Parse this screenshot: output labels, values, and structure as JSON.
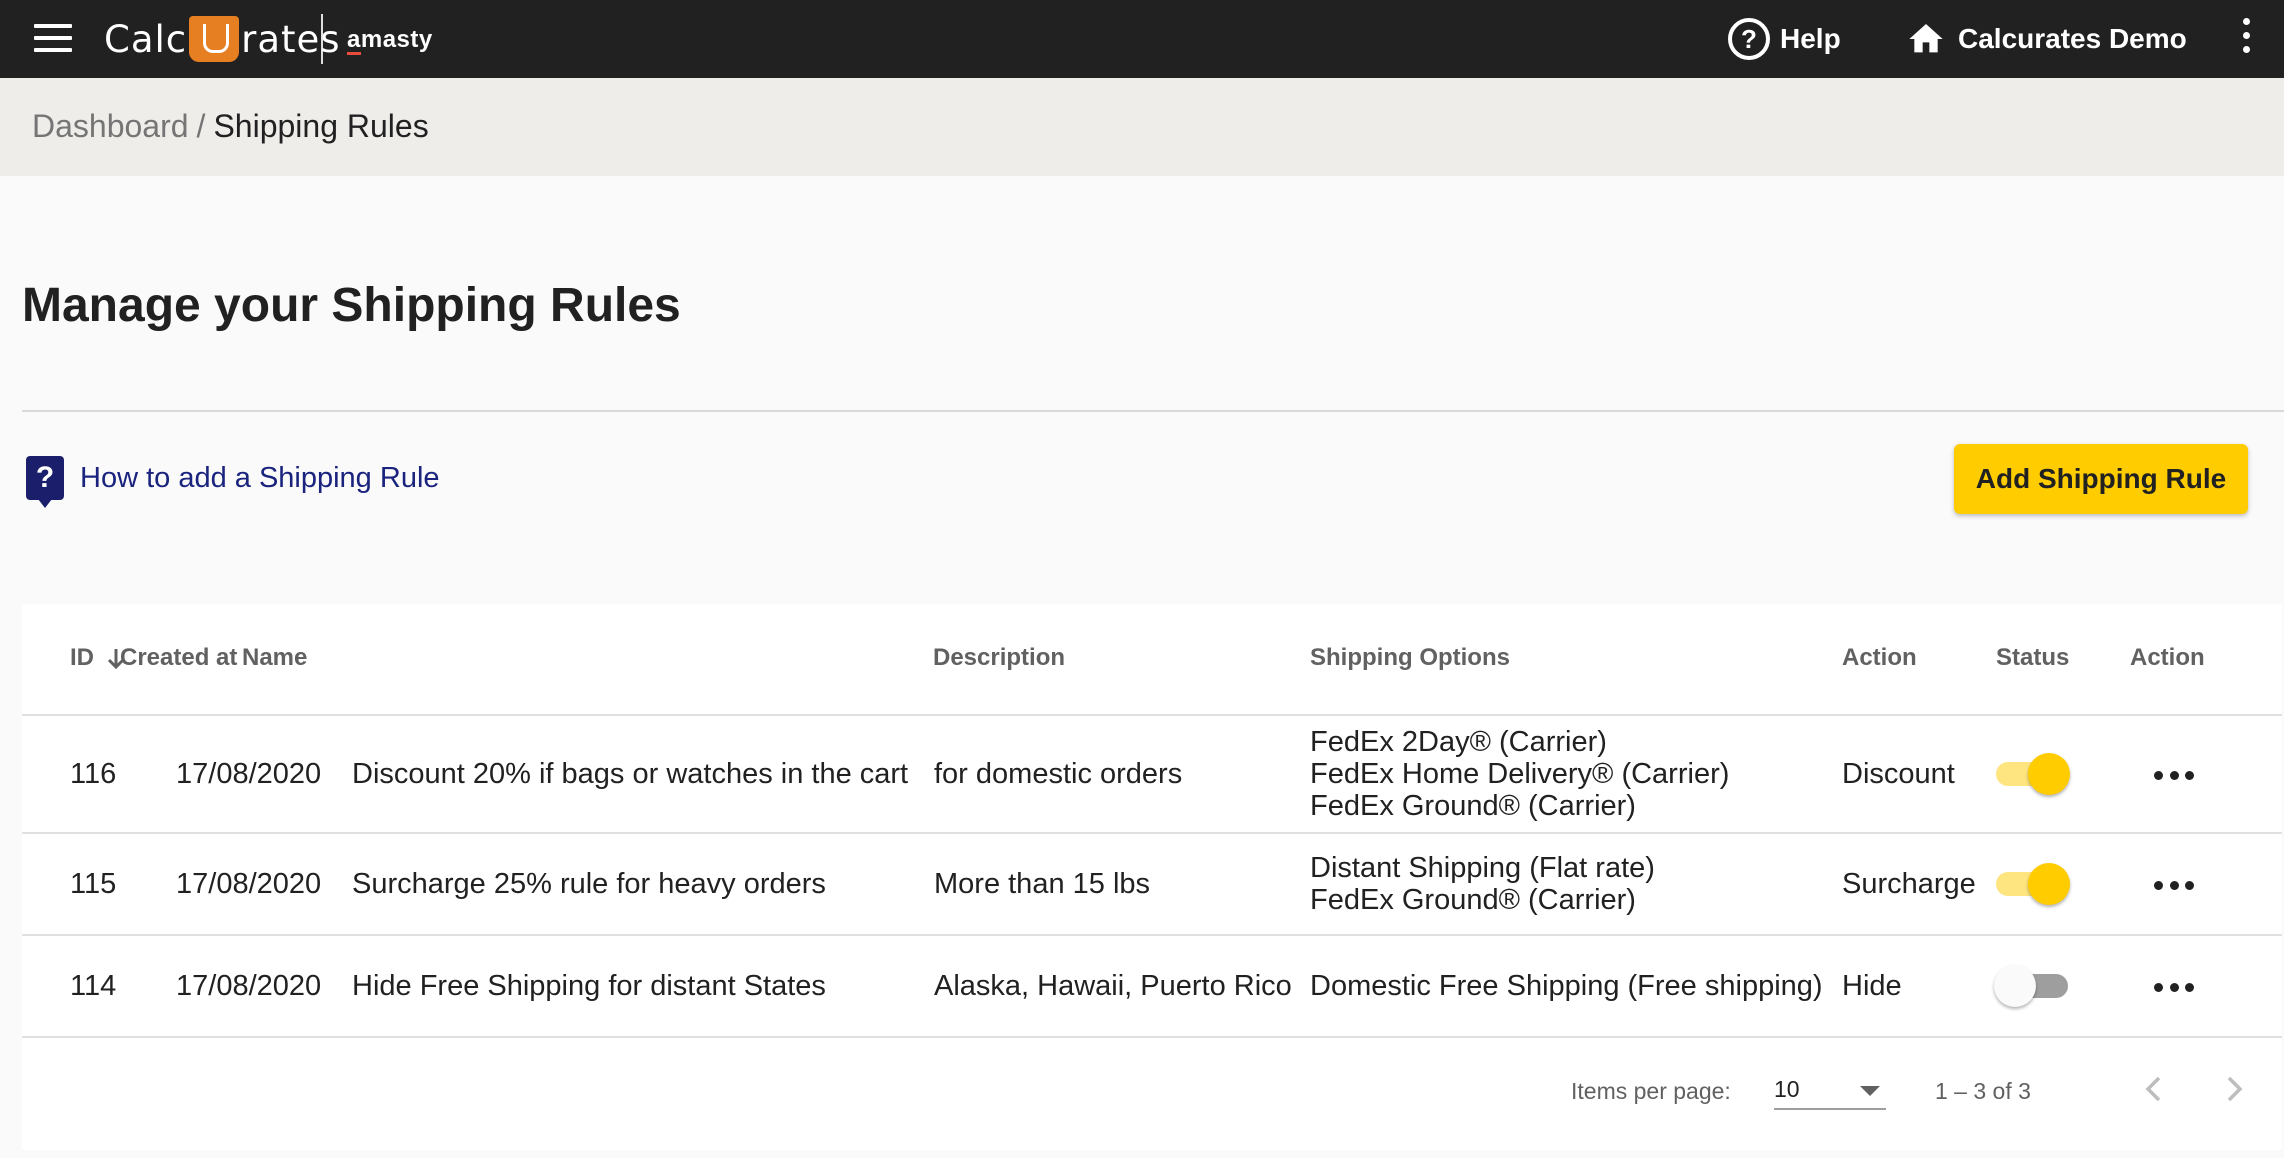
{
  "header": {
    "logo_left": "Calc",
    "logo_right": "rates",
    "brand2": "amasty",
    "help_label": "Help",
    "store_label": "Calcurates Demo"
  },
  "breadcrumb": {
    "parent": "Dashboard",
    "separator": "/",
    "current": "Shipping Rules"
  },
  "page": {
    "title": "Manage your Shipping Rules",
    "howto_label": "How to add a Shipping Rule",
    "howto_icon": "?",
    "add_button": "Add Shipping Rule"
  },
  "table": {
    "columns": [
      "ID",
      "Created at",
      "Name",
      "Description",
      "Shipping Options",
      "Action",
      "Status",
      "Action"
    ],
    "rows": [
      {
        "id": "116",
        "created": "17/08/2020",
        "name": "Discount 20% if bags or watches in the cart",
        "description": "for domestic orders",
        "options": [
          "FedEx 2Day® (Carrier)",
          "FedEx Home Delivery® (Carrier)",
          "FedEx Ground® (Carrier)"
        ],
        "action": "Discount",
        "status": "on"
      },
      {
        "id": "115",
        "created": "17/08/2020",
        "name": "Surcharge 25% rule for heavy orders",
        "description": "More than 15 lbs",
        "options": [
          "Distant Shipping (Flat rate)",
          "FedEx Ground® (Carrier)"
        ],
        "action": "Surcharge",
        "status": "on"
      },
      {
        "id": "114",
        "created": "17/08/2020",
        "name": "Hide Free Shipping for distant States",
        "description": "Alaska, Hawaii, Puerto Rico",
        "options": [
          "Domestic Free Shipping (Free shipping)"
        ],
        "action": "Hide",
        "status": "off"
      }
    ]
  },
  "paginator": {
    "items_per_page_label": "Items per page:",
    "items_per_page": "10",
    "range": "1 – 3 of 3"
  },
  "colors": {
    "topbar": "#212121",
    "accent": "#ffcc00",
    "link": "#1a237e",
    "logo_orange": "#e67e22"
  }
}
